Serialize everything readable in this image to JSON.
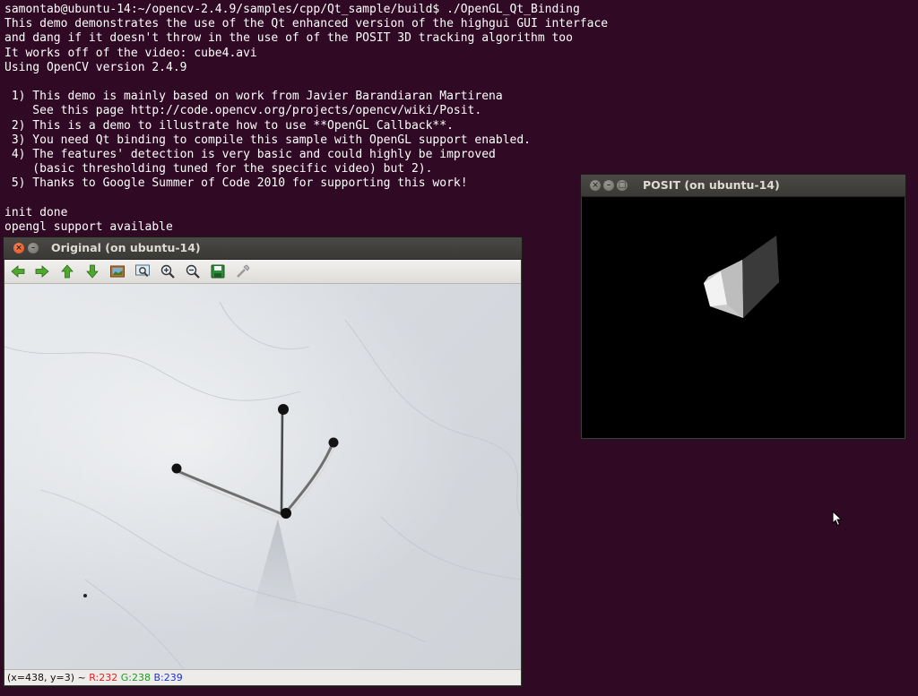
{
  "terminal": {
    "lines": [
      "samontab@ubuntu-14:~/opencv-2.4.9/samples/cpp/Qt_sample/build$ ./OpenGL_Qt_Binding",
      "This demo demonstrates the use of the Qt enhanced version of the highgui GUI interface",
      "and dang if it doesn't throw in the use of of the POSIT 3D tracking algorithm too",
      "It works off of the video: cube4.avi",
      "Using OpenCV version 2.4.9",
      "",
      " 1) This demo is mainly based on work from Javier Barandiaran Martirena",
      "    See this page http://code.opencv.org/projects/opencv/wiki/Posit.",
      " 2) This is a demo to illustrate how to use **OpenGL Callback**.",
      " 3) You need Qt binding to compile this sample with OpenGL support enabled.",
      " 4) The features' detection is very basic and could highly be improved",
      "    (basic thresholding tuned for the specific video) but 2).",
      " 5) Thanks to Google Summer of Code 2010 for supporting this work!",
      "",
      "init done",
      "opengl support available"
    ]
  },
  "original_window": {
    "title": "Original (on ubuntu-14)",
    "toolbar_icons": [
      "arrow-left-icon",
      "arrow-right-icon",
      "arrow-up-icon",
      "arrow-down-icon",
      "image-icon",
      "zoom-fit-icon",
      "zoom-in-icon",
      "zoom-out-icon",
      "save-icon",
      "properties-icon"
    ],
    "status": {
      "coords": "(x=438, y=3) ~ ",
      "r": "R:232",
      "g": "G:238",
      "b": "B:239"
    },
    "colors": {
      "r": "#e02020",
      "g": "#1f9a1f",
      "b": "#2030d0"
    }
  },
  "posit_window": {
    "title": "POSIT (on ubuntu-14)"
  },
  "colors": {
    "terminal_bg": "#300a24",
    "terminal_fg": "#ffffff",
    "titlebar": "#3c3b37",
    "close_button": "#df4a16"
  }
}
